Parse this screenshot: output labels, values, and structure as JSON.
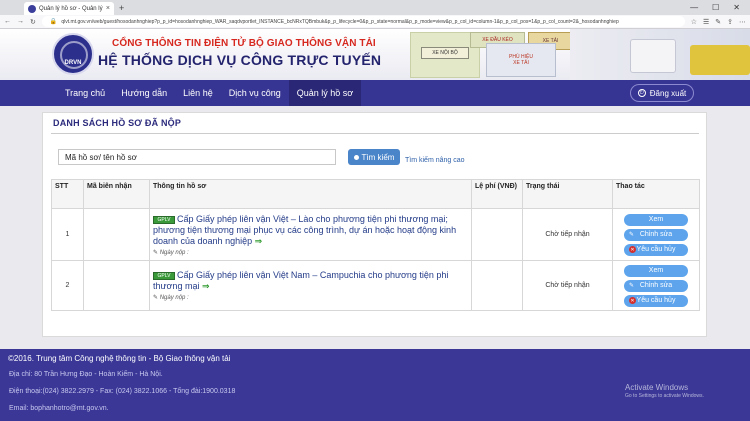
{
  "browser": {
    "tab_title": "Quản lý hồ sơ - Quản lý",
    "tab_close": "×",
    "new_tab": "+",
    "window_controls": [
      "—",
      "☐",
      "✕"
    ],
    "nav_buttons": [
      "←",
      "→",
      "↻"
    ],
    "url": "qlvt.mt.gov.vn/web/guest/hosodanhnghiep?p_p_id=hosodanhnghiep_WAR_saqdvportlet_INSTANCE_bcNRxTQBmbuk&p_p_lifecycle=0&p_p_state=normal&p_p_mode=view&p_p_col_id=column-1&p_p_col_pos=1&p_p_col_count=2&_hosodanhnghiep",
    "toolbar_icons": [
      "☆",
      "☰",
      "✎",
      "⇪",
      "⋯"
    ]
  },
  "header": {
    "org_name": "CỔNG THÔNG TIN ĐIỆN TỬ BỘ GIAO THÔNG VẬN TẢI",
    "system_name": "HỆ THỐNG DỊCH VỤ CÔNG TRỰC TUYẾN",
    "logo_text": "DRVN",
    "deco_plate_1": "XE NỘI BỘ",
    "deco_plate_2": "XE ĐẦU KÉO",
    "deco_plate_3": "XE TẢI",
    "deco_plate_4_line1": "PHÙ HIỆU",
    "deco_plate_4_line2": "XE TẢI"
  },
  "nav": {
    "items": [
      "Trang chủ",
      "Hướng dẫn",
      "Liên hệ",
      "Dịch vụ công",
      "Quản lý hồ sơ"
    ],
    "active_index": 4,
    "logout_label": "Đăng xuất"
  },
  "main": {
    "section_title": "DANH SÁCH HỒ SƠ ĐÃ NỘP",
    "search": {
      "value": "Mã hồ sơ/ tên hồ sơ",
      "button_label": "Tìm kiếm",
      "advanced_link": "Tìm kiếm nâng cao"
    },
    "table": {
      "columns": [
        "STT",
        "Mã biên nhận",
        "Thông tin hồ sơ",
        "Lệ phí (VNĐ)",
        "Trạng thái",
        "Thao tác"
      ],
      "rows": [
        {
          "stt": "1",
          "receipt": "",
          "badge": "GPLV",
          "info": "Cấp Giấy phép liên vận Việt – Lào cho phương tiện phi thương mại; phương tiện thương mại phục vụ các công trình, dự án hoặc hoạt động kinh doanh của doanh nghiệp",
          "arrow": "⇒",
          "date_label": "Ngày nộp :",
          "fee": "",
          "status": "Chờ tiếp nhận"
        },
        {
          "stt": "2",
          "receipt": "",
          "badge": "GPLV",
          "info": "Cấp Giấy phép liên vận Việt Nam – Campuchia cho phương tiện phi thương mại",
          "arrow": "⇒",
          "date_label": "Ngày nộp :",
          "fee": "",
          "status": "Chờ tiếp nhận"
        }
      ],
      "actions": {
        "view": "Xem",
        "edit": "Chỉnh sửa",
        "cancel": "Yêu cầu hủy"
      }
    }
  },
  "footer": {
    "copyright": "©2016. Trung tâm Công nghệ thông tin - Bộ Giao thông vận tải",
    "address": "Địa chỉ: 80 Trần Hưng Đạo - Hoàn Kiếm - Hà Nội.",
    "phone": "Điện thoại:(024) 3822.2979 - Fax: (024) 3822.1066 - Tổng đài:1900.0318",
    "email": "Email: bophanhotro@mt.gov.vn."
  },
  "os_watermark": {
    "line1": "Activate Windows",
    "line2": "Go to Settings to activate Windows."
  },
  "colors": {
    "nav_bg": "#373593",
    "footer_bg": "#3a3797",
    "title_red": "#d6281f",
    "title_navy": "#23236e",
    "action_blue": "#5da4ec",
    "search_blue": "#4a84c9"
  }
}
